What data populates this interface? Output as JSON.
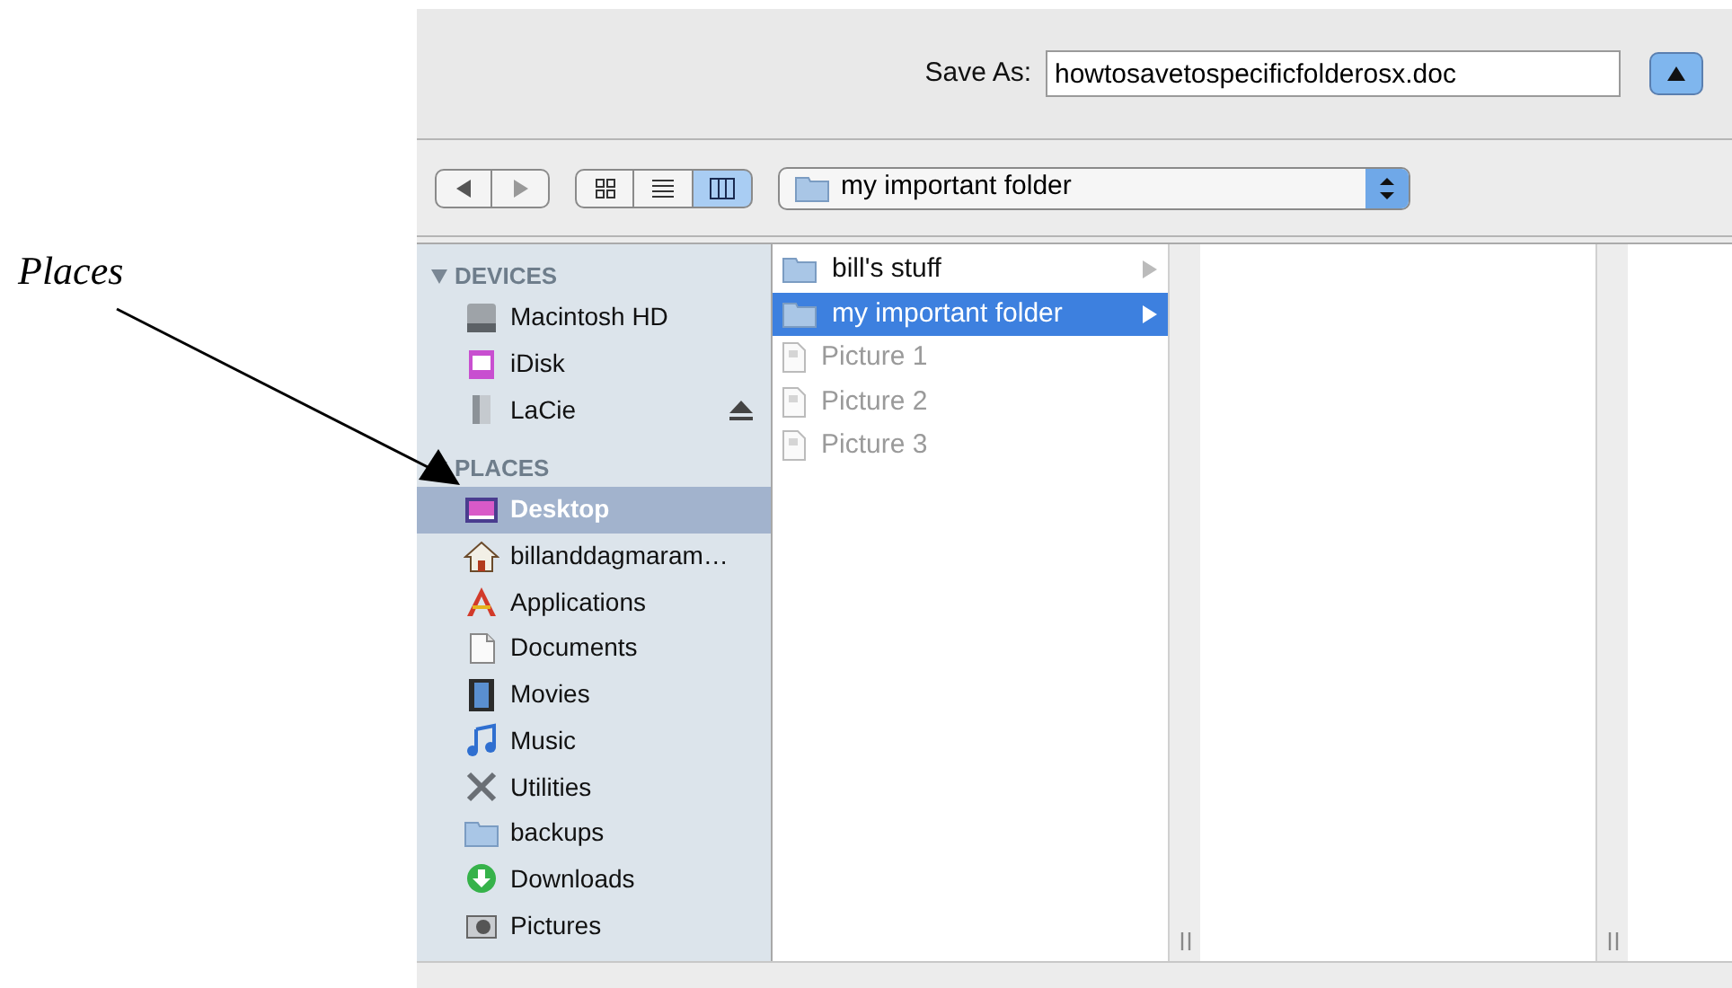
{
  "annotation": {
    "label": "Places"
  },
  "save_bar": {
    "label": "Save As:",
    "filename": "howtosavetospecificfolderosx.doc",
    "expanded": false
  },
  "toolbar": {
    "view_modes": [
      {
        "kind": "icons",
        "selected": false
      },
      {
        "kind": "list",
        "selected": false
      },
      {
        "kind": "columns",
        "selected": true
      }
    ],
    "location": "my important folder"
  },
  "sidebar": {
    "sections": [
      {
        "title": "DEVICES",
        "expanded": true,
        "items": [
          {
            "name": "Macintosh HD",
            "kind": "drive",
            "selected": false,
            "ejectable": false
          },
          {
            "name": "iDisk",
            "kind": "idisk",
            "selected": false,
            "ejectable": false
          },
          {
            "name": "LaCie",
            "kind": "external",
            "selected": false,
            "ejectable": true
          }
        ]
      },
      {
        "title": "PLACES",
        "expanded": true,
        "items": [
          {
            "name": "Desktop",
            "kind": "desktop",
            "selected": true,
            "ejectable": false
          },
          {
            "name": "billanddagmaram…",
            "kind": "home",
            "selected": false,
            "ejectable": false
          },
          {
            "name": "Applications",
            "kind": "apps",
            "selected": false,
            "ejectable": false
          },
          {
            "name": "Documents",
            "kind": "documents",
            "selected": false,
            "ejectable": false
          },
          {
            "name": "Movies",
            "kind": "movies",
            "selected": false,
            "ejectable": false
          },
          {
            "name": "Music",
            "kind": "music",
            "selected": false,
            "ejectable": false
          },
          {
            "name": "Utilities",
            "kind": "utilities",
            "selected": false,
            "ejectable": false
          },
          {
            "name": "backups",
            "kind": "folder",
            "selected": false,
            "ejectable": false
          },
          {
            "name": "Downloads",
            "kind": "downloads",
            "selected": false,
            "ejectable": false
          },
          {
            "name": "Pictures",
            "kind": "pictures",
            "selected": false,
            "ejectable": false
          }
        ]
      }
    ]
  },
  "columns": [
    {
      "items": [
        {
          "name": "bill's stuff",
          "kind": "folder",
          "selected": false,
          "disabled": false
        },
        {
          "name": "my important folder",
          "kind": "folder",
          "selected": true,
          "disabled": false
        },
        {
          "name": "Picture 1",
          "kind": "file",
          "selected": false,
          "disabled": true
        },
        {
          "name": "Picture 2",
          "kind": "file",
          "selected": false,
          "disabled": true
        },
        {
          "name": "Picture 3",
          "kind": "file",
          "selected": false,
          "disabled": true
        }
      ]
    },
    {},
    {}
  ]
}
